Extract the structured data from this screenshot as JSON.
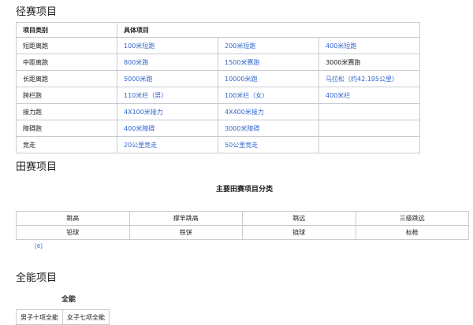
{
  "track": {
    "heading": "径赛项目",
    "col_headers": [
      "项目类别",
      "具体项目"
    ],
    "rows": [
      {
        "cat": "短距离跑",
        "items": [
          "100米短跑",
          "200米短跑",
          "400米短跑"
        ]
      },
      {
        "cat": "中距离跑",
        "items": [
          "800米跑",
          "1500米赛跑",
          "3000米赛跑"
        ]
      },
      {
        "cat": "长距离跑",
        "items": [
          "5000米跑",
          "10000米跑",
          "马拉松（约42.195公里）"
        ]
      },
      {
        "cat": "跨栏跑",
        "items": [
          "110米栏（男）",
          "100米栏（女）",
          "400米栏"
        ]
      },
      {
        "cat": "接力跑",
        "items": [
          "4X100米接力",
          "4X400米接力",
          ""
        ]
      },
      {
        "cat": "障碍跑",
        "items": [
          "400米障碍",
          "3000米障碍",
          ""
        ]
      },
      {
        "cat": "竞走",
        "items": [
          "20公里竞走",
          "50公里竞走",
          ""
        ]
      }
    ]
  },
  "field": {
    "heading": "田赛项目",
    "caption": "主要田赛项目分类",
    "rows": [
      [
        "跳高",
        "撑竿跳高",
        "跳远",
        "三级跳远"
      ],
      [
        "铅球",
        "铁饼",
        "链球",
        "标枪"
      ]
    ],
    "ref": "[6]"
  },
  "combined": {
    "heading": "全能项目",
    "caption": "全能",
    "items": [
      "男子十项全能",
      "女子七项全能"
    ]
  }
}
